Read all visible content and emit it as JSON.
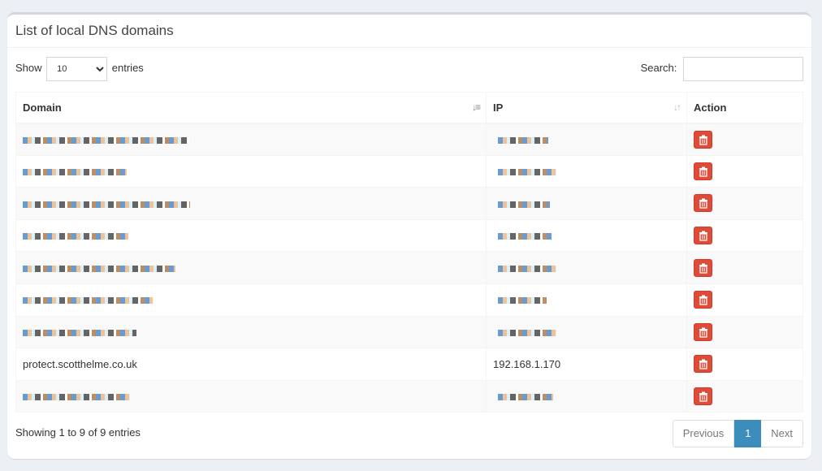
{
  "box": {
    "title": "List of local DNS domains"
  },
  "controls": {
    "show_label": "Show",
    "entries_label": "entries",
    "page_length_selected": "10",
    "search_label": "Search:",
    "search_value": "",
    "search_placeholder": ""
  },
  "table": {
    "columns": [
      "Domain",
      "IP",
      "Action"
    ],
    "rows": [
      {
        "domain": "[redacted]",
        "ip": "[redacted]",
        "redacted": true
      },
      {
        "domain": "[redacted]",
        "ip": "[redacted]",
        "redacted": true
      },
      {
        "domain": "[redacted]",
        "ip": "[redacted]",
        "redacted": true
      },
      {
        "domain": "[redacted]",
        "ip": "[redacted]",
        "redacted": true
      },
      {
        "domain": "[redacted]",
        "ip": "[redacted]",
        "redacted": true
      },
      {
        "domain": "[redacted]",
        "ip": "[redacted]",
        "redacted": true
      },
      {
        "domain": "[redacted]",
        "ip": "[redacted]",
        "redacted": true
      },
      {
        "domain": "protect.scotthelme.co.uk",
        "ip": "192.168.1.170",
        "redacted": false
      },
      {
        "domain": "[redacted]",
        "ip": "[redacted]",
        "redacted": true
      }
    ],
    "action_icon": "trash-icon",
    "colors": {
      "delete_button": "#dd4b39",
      "active_page": "#3c8dbc"
    }
  },
  "footer": {
    "info": "Showing 1 to 9 of 9 entries",
    "previous_label": "Previous",
    "current_page": "1",
    "next_label": "Next"
  }
}
